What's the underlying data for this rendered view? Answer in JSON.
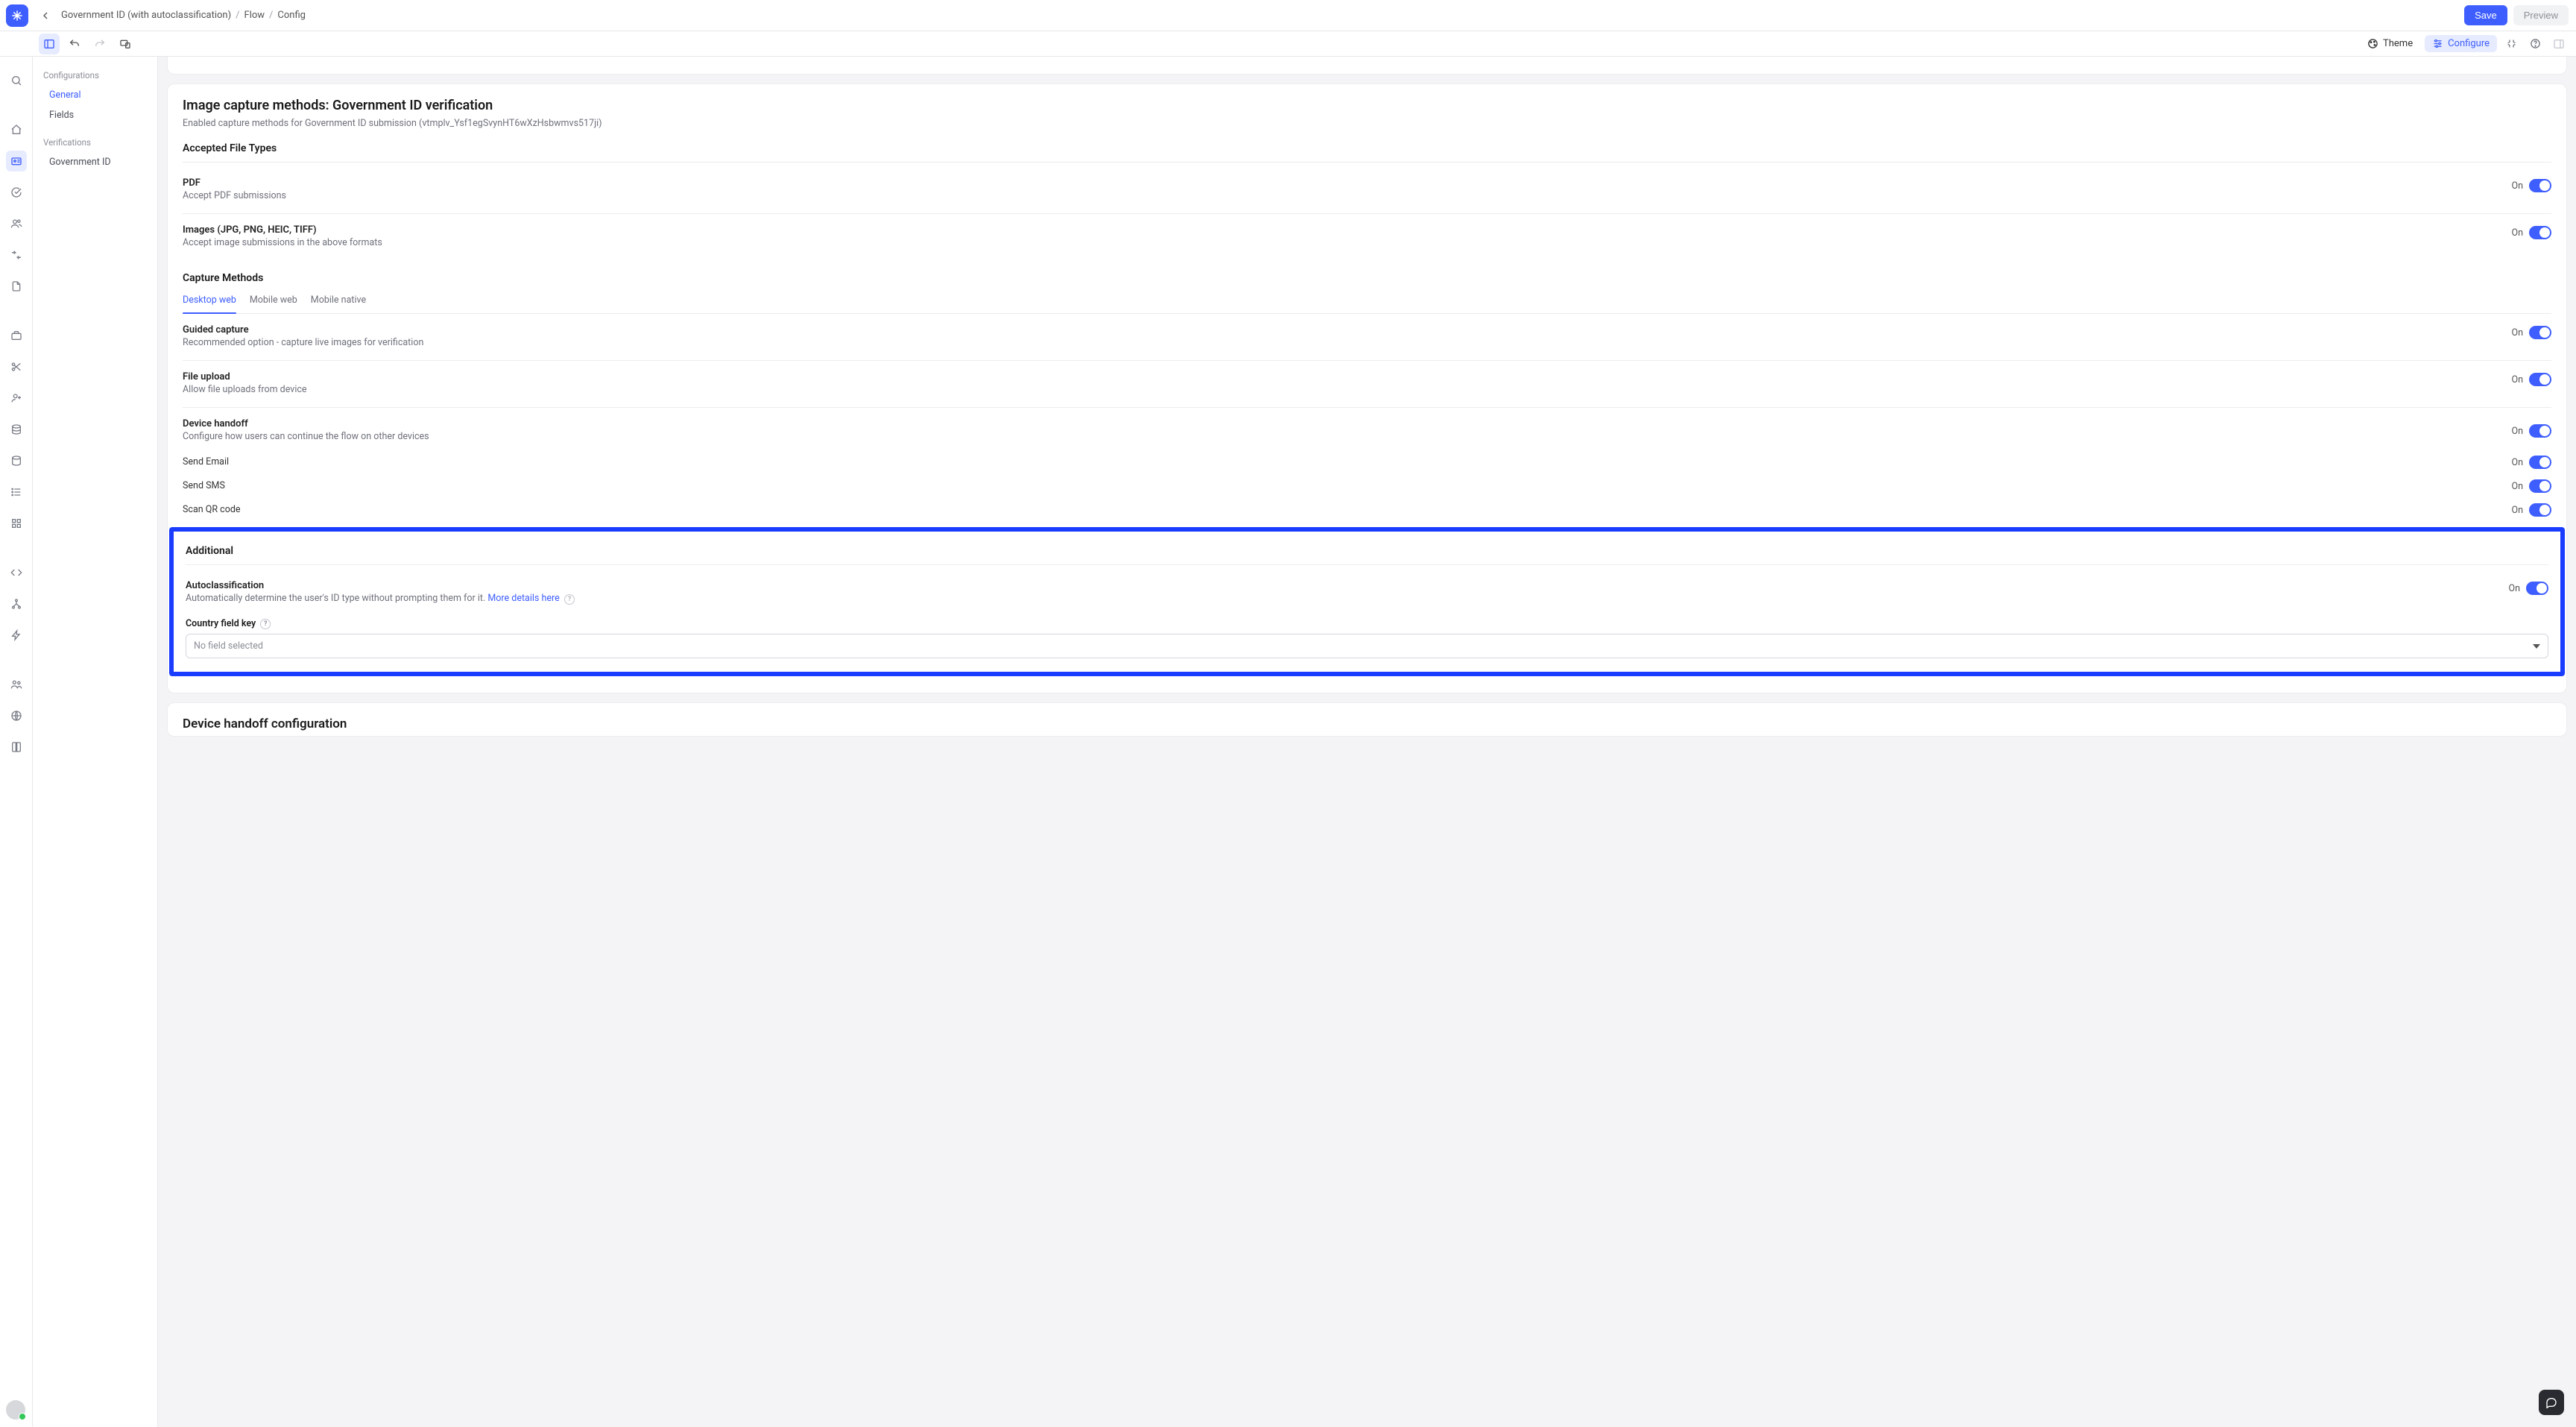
{
  "header": {
    "breadcrumb_title": "Government ID (with autoclassification)",
    "crumb_flow": "Flow",
    "crumb_config": "Config",
    "save_label": "Save",
    "preview_label": "Preview"
  },
  "toolbar": {
    "theme_label": "Theme",
    "configure_label": "Configure"
  },
  "left_panel": {
    "configurations_title": "Configurations",
    "general_label": "General",
    "fields_label": "Fields",
    "verifications_title": "Verifications",
    "gov_id_label": "Government ID"
  },
  "image_capture": {
    "title": "Image capture methods: Government ID verification",
    "subtext": "Enabled capture methods for Government ID submission (vtmplv_Ysf1egSvynHT6wXzHsbwmvs517ji)",
    "accepted_heading": "Accepted File Types",
    "pdf_label": "PDF",
    "pdf_desc": "Accept PDF submissions",
    "images_label": "Images (JPG, PNG, HEIC, TIFF)",
    "images_desc": "Accept image submissions in the above formats",
    "methods_heading": "Capture Methods",
    "tab_desktop": "Desktop web",
    "tab_mobile_web": "Mobile web",
    "tab_native": "Mobile native",
    "guided_label": "Guided capture",
    "guided_desc": "Recommended option - capture live images for verification",
    "upload_label": "File upload",
    "upload_desc": "Allow file uploads from device",
    "handoff_label": "Device handoff",
    "handoff_desc": "Configure how users can continue the flow on other devices",
    "send_email": "Send Email",
    "send_sms": "Send SMS",
    "scan_qr": "Scan QR code",
    "additional_heading": "Additional",
    "autoclass_label": "Autoclassification",
    "autoclass_desc": "Automatically determine the user's ID type without prompting them for it. ",
    "autoclass_link": "More details here",
    "country_key_label": "Country field key",
    "country_placeholder": "No field selected",
    "on_label": "On"
  },
  "device_handoff_card": {
    "title": "Device handoff configuration"
  }
}
